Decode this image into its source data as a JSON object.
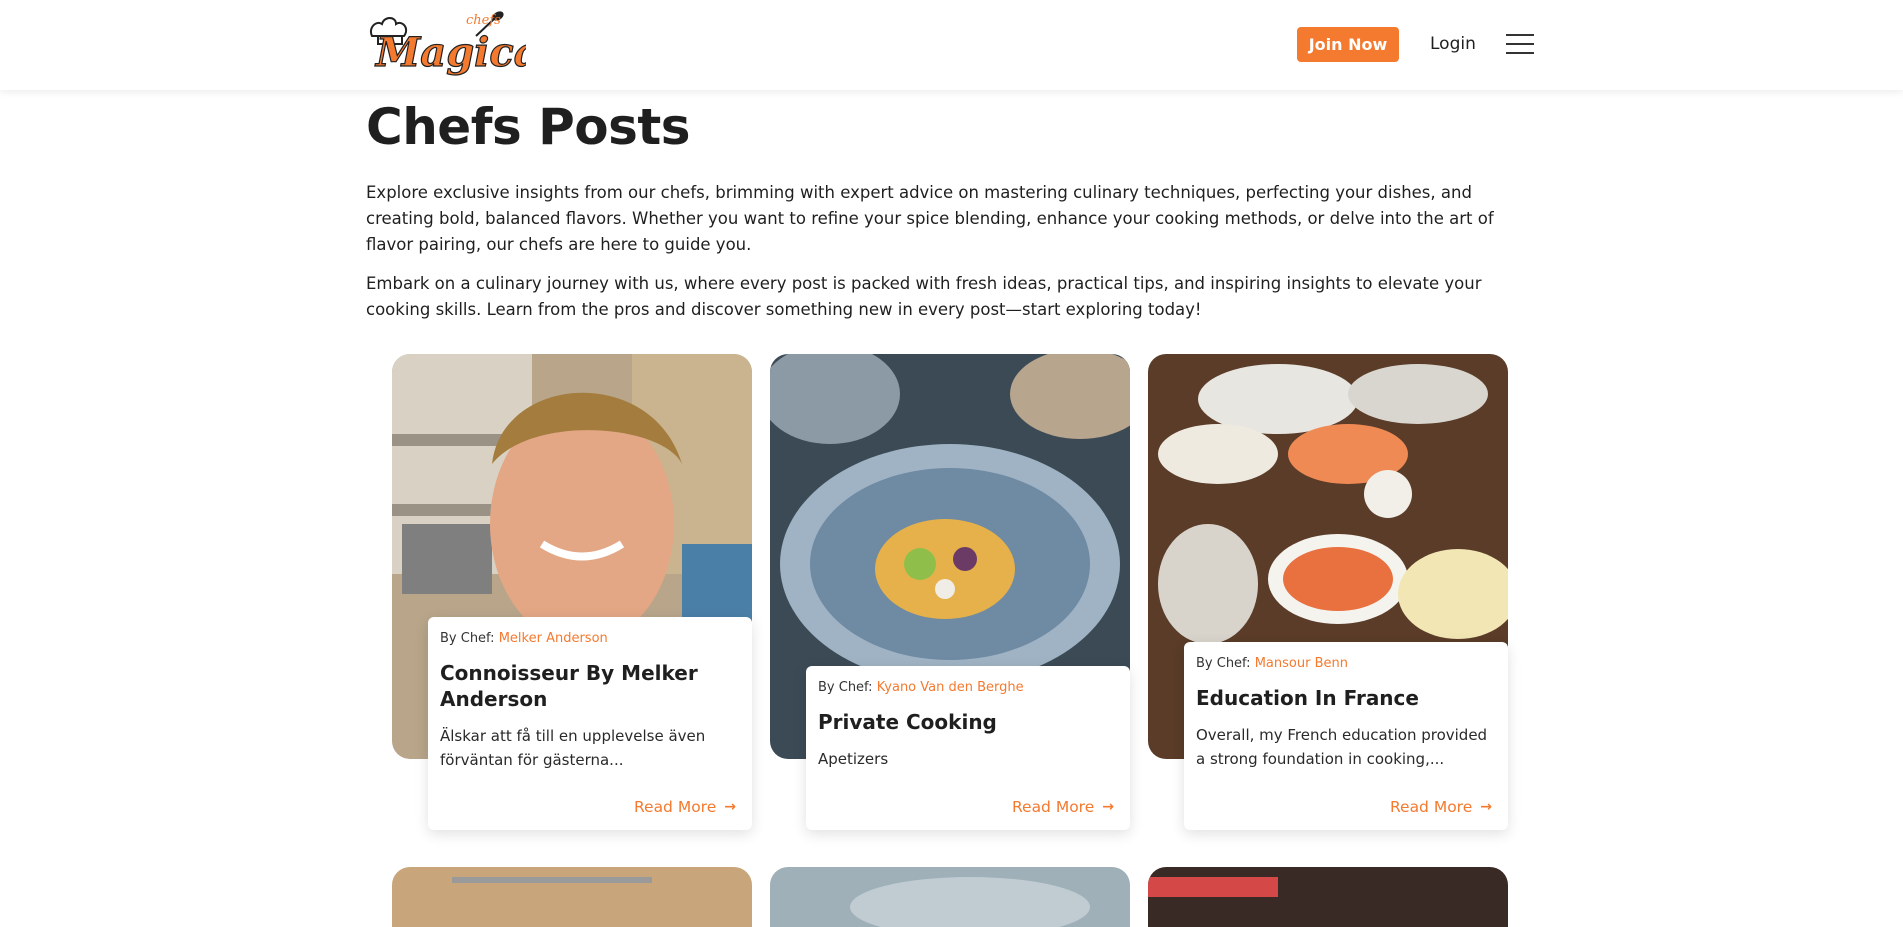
{
  "header": {
    "logo_text": "Magical",
    "logo_small_text": "chefs",
    "join_label": "Join Now",
    "login_label": "Login",
    "menu_icon": "hamburger-menu-icon"
  },
  "main": {
    "title": "Chefs Posts",
    "intro_1": "Explore exclusive insights from our chefs, brimming with expert advice on mastering culinary techniques, perfecting your dishes, and creating bold, balanced flavors. Whether you want to refine your spice blending, enhance your cooking methods, or delve into the art of flavor pairing, our chefs are here to guide you.",
    "intro_2": "Embark on a culinary journey with us, where every post is packed with fresh ideas, practical tips, and inspiring insights to elevate your cooking skills. Learn from the pros and discover something new in every post—start exploring today!"
  },
  "posts": [
    {
      "by_prefix": "By Chef:",
      "chef": "Melker Anderson",
      "title": "Connoisseur By Melker Anderson",
      "desc": "Älskar att få till en upplevelse även förväntan för gästerna...",
      "read_more": "Read More"
    },
    {
      "by_prefix": "By Chef:",
      "chef": "Kyano Van den Berghe",
      "title": "Private Cooking",
      "desc": "Apetizers",
      "read_more": "Read More"
    },
    {
      "by_prefix": "By Chef:",
      "chef": "Mansour Benn",
      "title": "Education In France",
      "desc": "Overall, my French education provided a strong foundation in cooking,...",
      "read_more": "Read More"
    }
  ],
  "colors": {
    "accent": "#f47a2f",
    "text": "#1f1f1f"
  }
}
